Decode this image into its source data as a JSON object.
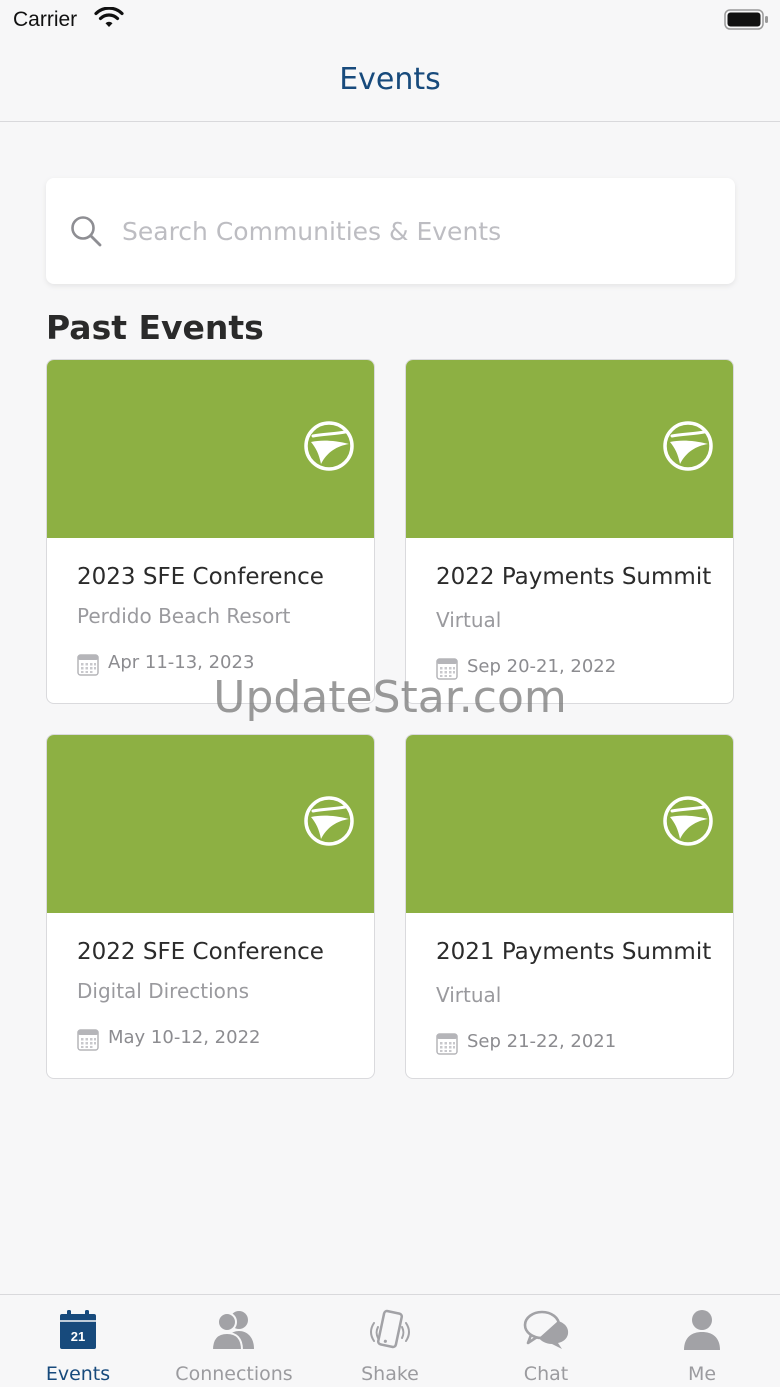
{
  "status_bar": {
    "carrier": "Carrier"
  },
  "nav": {
    "title": "Events"
  },
  "search": {
    "placeholder": "Search Communities & Events",
    "value": ""
  },
  "section": {
    "title": "Past Events"
  },
  "events": [
    {
      "title": "2023 SFE Conference",
      "venue": "Perdido Beach Resort",
      "date": "Apr 11-13, 2023"
    },
    {
      "title": "2022 Payments Summit",
      "venue": "Virtual",
      "date": "Sep 20-21, 2022"
    },
    {
      "title": "2022 SFE Conference",
      "venue": "Digital Directions",
      "date": "May 10-12, 2022"
    },
    {
      "title": "2021 Payments Summit",
      "venue": "Virtual",
      "date": "Sep 21-22, 2021"
    }
  ],
  "watermark": "UpdateStar.com",
  "tab_bar": {
    "calendar_day": "21",
    "tabs": [
      {
        "label": "Events",
        "icon": "calendar-icon",
        "active": true
      },
      {
        "label": "Connections",
        "icon": "people-icon",
        "active": false
      },
      {
        "label": "Shake",
        "icon": "shake-phone-icon",
        "active": false
      },
      {
        "label": "Chat",
        "icon": "chat-bubbles-icon",
        "active": false
      },
      {
        "label": "Me",
        "icon": "person-icon",
        "active": false
      }
    ]
  },
  "colors": {
    "accent": "#174a7c",
    "banner": "#8db043",
    "inactive": "#9b9b9f"
  }
}
